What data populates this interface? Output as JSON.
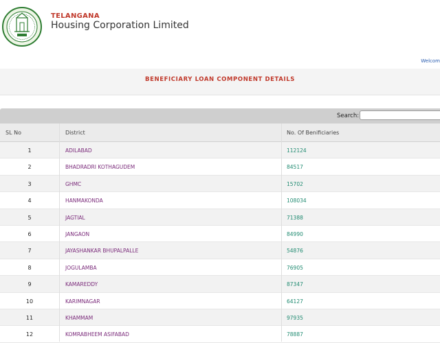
{
  "header": {
    "org_line1": "TELANGANA",
    "org_line2": "Housing Corporation Limited",
    "logo_icon": "telangana-government-seal"
  },
  "welcome_text": "Welcom",
  "page_title": "BENEFICIARY LOAN COMPONENT DETAILS",
  "search": {
    "label": "Search:",
    "value": ""
  },
  "table": {
    "headers": [
      "SL No",
      "District",
      "No. Of Benificiaries"
    ],
    "rows": [
      {
        "sl": "1",
        "district": "ADILABAD",
        "count": "112124"
      },
      {
        "sl": "2",
        "district": "BHADRADRI KOTHAGUDEM",
        "count": "84517"
      },
      {
        "sl": "3",
        "district": "GHMC",
        "count": "15702"
      },
      {
        "sl": "4",
        "district": "HANMAKONDA",
        "count": "108034"
      },
      {
        "sl": "5",
        "district": "JAGTIAL",
        "count": "71388"
      },
      {
        "sl": "6",
        "district": "JANGAON",
        "count": "84990"
      },
      {
        "sl": "7",
        "district": "JAYASHANKAR BHUPALPALLE",
        "count": "54876"
      },
      {
        "sl": "8",
        "district": "JOGULAMBA",
        "count": "76905"
      },
      {
        "sl": "9",
        "district": "KAMAREDDY",
        "count": "87347"
      },
      {
        "sl": "10",
        "district": "KARIMNAGAR",
        "count": "64127"
      },
      {
        "sl": "11",
        "district": "KHAMMAM",
        "count": "97935"
      },
      {
        "sl": "12",
        "district": "KOMRABHEEM ASIFABAD",
        "count": "78887"
      }
    ]
  },
  "colors": {
    "title": "#c0392b",
    "district": "#7a2a7a",
    "count": "#1f8a70",
    "link": "#2a5db0"
  }
}
